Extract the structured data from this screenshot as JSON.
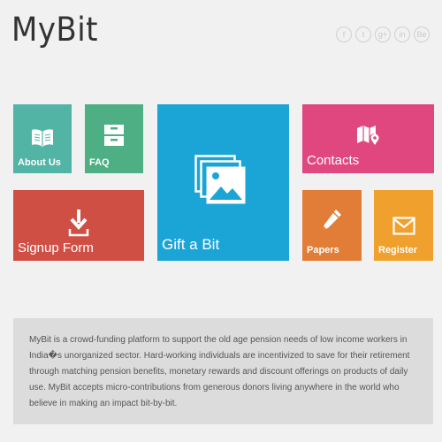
{
  "header": {
    "logo_text": "MyBit",
    "social": [
      {
        "icon": "facebook-icon",
        "glyph": "f"
      },
      {
        "icon": "twitter-icon",
        "glyph": "t"
      },
      {
        "icon": "google-plus-icon",
        "glyph": "g+"
      },
      {
        "icon": "linkedin-icon",
        "glyph": "in"
      },
      {
        "icon": "be-icon",
        "glyph": "Be"
      }
    ]
  },
  "tiles": {
    "about": {
      "label": "About Us",
      "icon": "book-icon",
      "color": "#52b4a5"
    },
    "faq": {
      "label": "FAQ",
      "icon": "archive-drawer-icon",
      "color": "#4daf83"
    },
    "gift": {
      "label": "Gift a Bit",
      "icon": "image-stack-icon",
      "color": "#1ba5d7"
    },
    "contacts": {
      "label": "Contacts",
      "icon": "map-pin-icon",
      "color": "#e0477f"
    },
    "signup": {
      "label": "Signup Form",
      "icon": "download-icon",
      "color": "#d04f44"
    },
    "papers": {
      "label": "Papers",
      "icon": "pencil-icon",
      "color": "#e17d37"
    },
    "register": {
      "label": "Register",
      "icon": "envelope-icon",
      "color": "#f0a02c"
    }
  },
  "description": {
    "text": "MyBit is a crowd-funding platform to support the old age pension needs of low income workers in India�s unorganized sector. Hard-working individuals are incentivized to save for their retirement through matching pension benefits, monetary rewards and discount offerings on products of daily use. MyBit accepts micro-contributions from generous donors living anywhere in the world who believe in making an impact bit-by-bit."
  }
}
